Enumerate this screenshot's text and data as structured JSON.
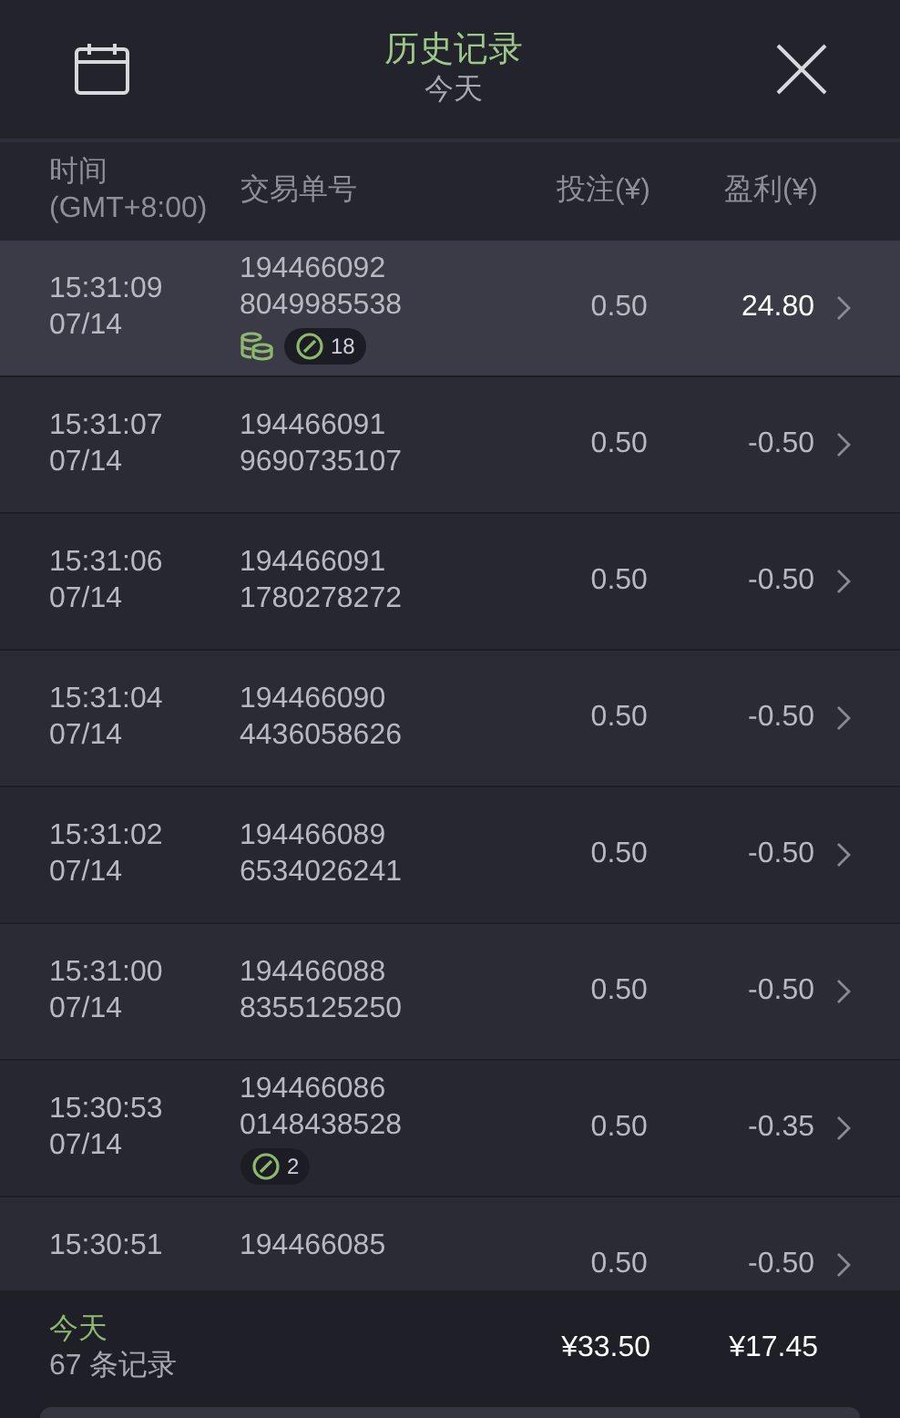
{
  "header": {
    "title": "历史记录",
    "subtitle": "今天"
  },
  "columns": [
    {
      "label": "时间",
      "sublabel": "(GMT+8:00)"
    },
    {
      "label": "交易单号"
    },
    {
      "label": "投注(¥)"
    },
    {
      "label": "盈利(¥)"
    }
  ],
  "rows": [
    {
      "selected": true,
      "time": "15:31:09",
      "date": "07/14",
      "id_line1": "194466092",
      "id_line2": "8049985538",
      "stake": "0.50",
      "profit": "24.80",
      "positive": true,
      "badges": [
        {
          "kind": "coins"
        },
        {
          "kind": "count",
          "text": "18"
        }
      ]
    },
    {
      "selected": false,
      "time": "15:31:07",
      "date": "07/14",
      "id_line1": "194466091",
      "id_line2": "9690735107",
      "stake": "0.50",
      "profit": "-0.50",
      "positive": false
    },
    {
      "selected": false,
      "time": "15:31:06",
      "date": "07/14",
      "id_line1": "194466091",
      "id_line2": "1780278272",
      "stake": "0.50",
      "profit": "-0.50",
      "positive": false
    },
    {
      "selected": false,
      "time": "15:31:04",
      "date": "07/14",
      "id_line1": "194466090",
      "id_line2": "4436058626",
      "stake": "0.50",
      "profit": "-0.50",
      "positive": false
    },
    {
      "selected": false,
      "time": "15:31:02",
      "date": "07/14",
      "id_line1": "194466089",
      "id_line2": "6534026241",
      "stake": "0.50",
      "profit": "-0.50",
      "positive": false
    },
    {
      "selected": false,
      "time": "15:31:00",
      "date": "07/14",
      "id_line1": "194466088",
      "id_line2": "8355125250",
      "stake": "0.50",
      "profit": "-0.50",
      "positive": false
    },
    {
      "selected": false,
      "time": "15:30:53",
      "date": "07/14",
      "id_line1": "194466086",
      "id_line2": "0148438528",
      "stake": "0.50",
      "profit": "-0.35",
      "positive": false,
      "badges": [
        {
          "kind": "count",
          "text": "2"
        }
      ]
    },
    {
      "selected": false,
      "time": "15:30:51",
      "id_line1": "194466085",
      "stake": "0.50",
      "profit": "-0.50",
      "positive": false
    }
  ],
  "footer": {
    "period": "今天",
    "count": "67 条记录",
    "total_stake": "¥33.50",
    "total_profit": "¥17.45"
  }
}
